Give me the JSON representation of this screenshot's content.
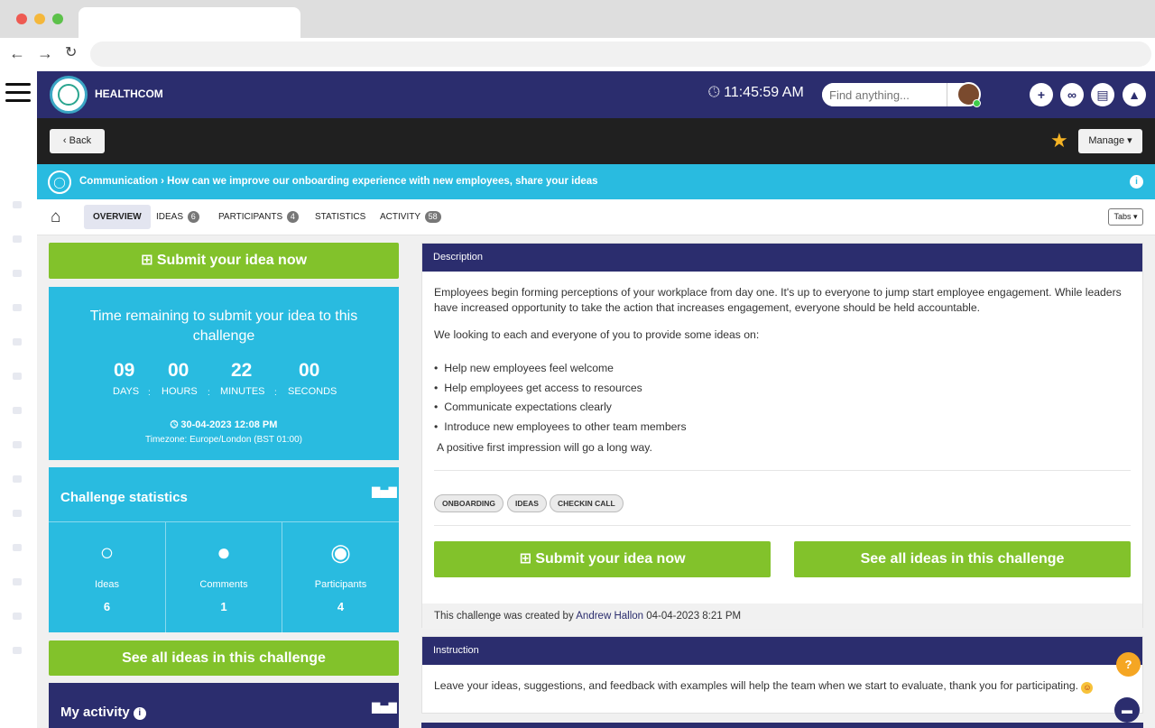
{
  "app": {
    "brand": "HEALTHCOM",
    "clock": "11:45:59 AM",
    "search": {
      "placeholder": "Find anything..."
    },
    "header_buttons": [
      "plus-icon",
      "link-icon",
      "calendar-icon",
      "bell-icon"
    ]
  },
  "subheader": {
    "back_label": "Back",
    "manage_label": "Manage"
  },
  "breadcrumb": {
    "section": "Communication",
    "separator": "›",
    "title": "How can we improve our onboarding experience with new employees, share your ideas"
  },
  "tabs": {
    "overview": "OVERVIEW",
    "ideas": {
      "label": "IDEAS",
      "count": "6"
    },
    "participants": {
      "label": "PARTICIPANTS",
      "count": "4"
    },
    "statistics": "STATISTICS",
    "activity": {
      "label": "ACTIVITY",
      "count": "58"
    },
    "tabs_button": "Tabs"
  },
  "left": {
    "submit_label": "Submit your idea now",
    "timer": {
      "title": "Time remaining to submit your idea to this challenge",
      "days": "09",
      "days_label": "DAYS",
      "hours": "00",
      "hours_label": "HOURS",
      "minutes": "22",
      "minutes_label": "MINUTES",
      "seconds": "00",
      "seconds_label": "SECONDS",
      "deadline": "30-04-2023 12:08 PM",
      "timezone": "Timezone: Europe/London (BST 01:00)"
    },
    "stats": {
      "title": "Challenge statistics",
      "ideas_label": "Ideas",
      "ideas_value": "6",
      "comments_label": "Comments",
      "comments_value": "1",
      "participants_label": "Participants",
      "participants_value": "4"
    },
    "see_all_label": "See all ideas in this challenge",
    "activity_title": "My activity"
  },
  "description": {
    "heading": "Description",
    "para1": "Employees begin forming perceptions of your workplace from day one. It's up to everyone to jump start employee engagement. While leaders have increased opportunity to take the action that increases engagement, everyone should be held accountable.",
    "para2": "We looking to each and everyone of you to provide some ideas on:",
    "bullets": [
      "Help new employees feel welcome",
      "Help employees get access to resources",
      "Communicate expectations clearly",
      "Introduce new employees to other team members"
    ],
    "para3": "A positive first impression will go a long way.",
    "tags": [
      "ONBOARDING",
      "IDEAS",
      "CHECKIN CALL"
    ],
    "submit_label": "Submit your idea now",
    "see_all_label": "See all ideas in this challenge",
    "created_prefix": "This challenge was created by",
    "created_by": "Andrew Hallon",
    "created_at": "04-04-2023 8:21 PM"
  },
  "instruction": {
    "heading": "Instruction",
    "text": "Leave your ideas, suggestions, and feedback with examples will help the team when we start to evaluate, thank you for participating."
  },
  "colors": {
    "navy": "#2b2d6e",
    "cyan": "#29bbe0",
    "green": "#82c22b",
    "dark": "#202020"
  }
}
